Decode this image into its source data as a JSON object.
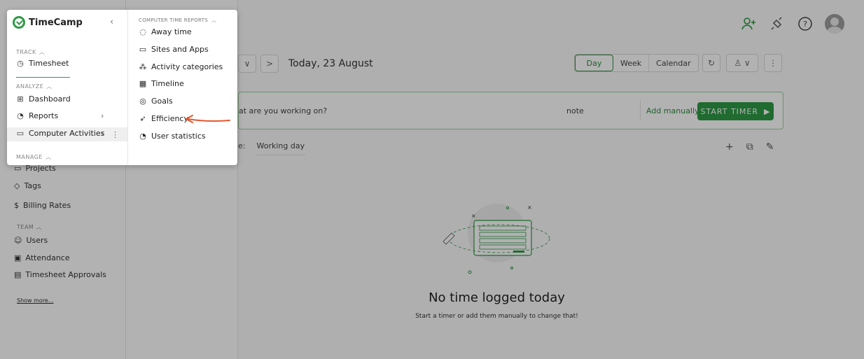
{
  "app": {
    "brand": "TimeCamp",
    "accent_color": "#2e9a46"
  },
  "top_bar": {
    "icons": [
      "add-user-icon",
      "plug-icon",
      "help-icon",
      "user-avatar"
    ]
  },
  "date_nav": {
    "label": "Today, 23 August",
    "prev": "<",
    "dropdown": "∨",
    "next": ">"
  },
  "view_tabs": [
    {
      "label": "Day",
      "active": true
    },
    {
      "label": "Week",
      "active": false
    },
    {
      "label": "Calendar",
      "active": false
    }
  ],
  "timer_bar": {
    "placeholder": "at are you working on?",
    "note": "note",
    "add_manually": "Add manually",
    "start_timer": "START TIMER"
  },
  "work_type": {
    "label": "e:",
    "value": "Working day"
  },
  "empty_state": {
    "title": "No time logged today",
    "subtitle": "Start a timer or add them manually to change that!"
  },
  "sidebar": {
    "sections": {
      "track": "TRACK",
      "analyze": "ANALYZE",
      "manage": "MANAGE",
      "team": "TEAM"
    },
    "items": {
      "timesheet": "Timesheet",
      "dashboard": "Dashboard",
      "reports": "Reports",
      "computer_activities": "Computer Activities",
      "projects": "Projects",
      "tags": "Tags",
      "billing_rates": "Billing Rates",
      "users": "Users",
      "attendance": "Attendance",
      "timesheet_approvals": "Timesheet Approvals"
    },
    "show_more": "Show more..."
  },
  "submenu": {
    "heading": "COMPUTER TIME REPORTS",
    "items": [
      {
        "label": "Away time",
        "icon": "away-icon"
      },
      {
        "label": "Sites and Apps",
        "icon": "laptop-icon"
      },
      {
        "label": "Activity categories",
        "icon": "categories-icon"
      },
      {
        "label": "Timeline",
        "icon": "calendar-grid-icon"
      },
      {
        "label": "Goals",
        "icon": "target-icon"
      },
      {
        "label": "Efficiency",
        "icon": "rocket-icon"
      },
      {
        "label": "User statistics",
        "icon": "pie-chart-icon"
      }
    ]
  },
  "annotation": {
    "arrow_color": "#e4572e"
  }
}
